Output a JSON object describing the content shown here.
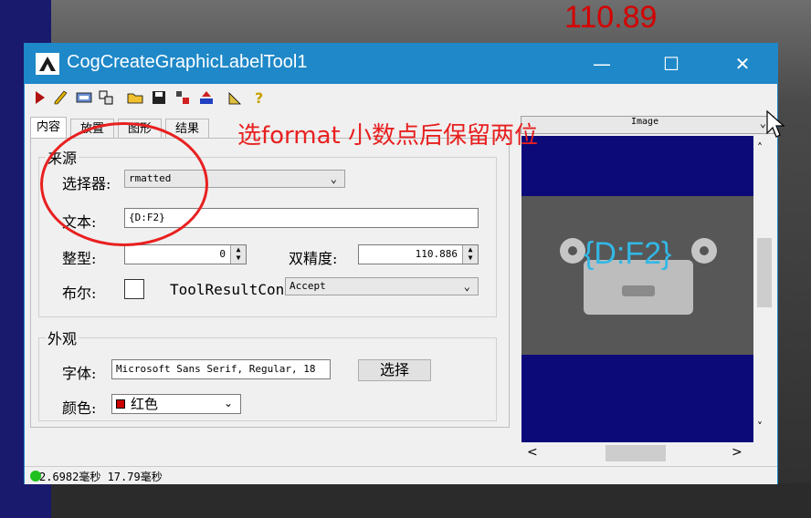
{
  "background": {
    "value": "110.89",
    "value_color": "#d40000"
  },
  "window": {
    "title": "CogCreateGraphicLabelTool1",
    "controls": {
      "minimize": "—",
      "maximize": "☐",
      "close": "✕"
    },
    "titlebar_color": "#1e88c8"
  },
  "toolbar": [
    "run-icon",
    "edit-icon",
    "display-icon",
    "link-icon",
    "open-icon",
    "save-icon",
    "settings-icon",
    "import-icon",
    "measure-icon",
    "help-icon"
  ],
  "tabs": [
    "内容",
    "放置",
    "图形",
    "结果"
  ],
  "source": {
    "group_label": "来源",
    "selector_label": "选择器:",
    "selector_value": "rmatted",
    "text_label": "文本:",
    "text_value": "{D:F2}",
    "integer_label": "整型:",
    "integer_value": "0",
    "double_label": "双精度:",
    "double_value": "110.886",
    "bool_label": "布尔:",
    "tool_result_label": "ToolResultCon",
    "tool_result_value": "Accept"
  },
  "appearance": {
    "group_label": "外观",
    "font_label": "字体:",
    "font_value": "Microsoft Sans Serif, Regular, 18",
    "choose_button": "选择",
    "color_label": "颜色:",
    "color_value": "红色",
    "color_swatch": "#cc0000"
  },
  "image_panel": {
    "selector_value": "Image",
    "label_text": "{D:F2}",
    "label_color": "#33b8e6"
  },
  "status": {
    "text": "2.6982毫秒 17.79毫秒",
    "dot_color": "#1fc01f"
  },
  "annotation": {
    "text": "选format 小数点后保留两位",
    "color": "#e82020"
  }
}
